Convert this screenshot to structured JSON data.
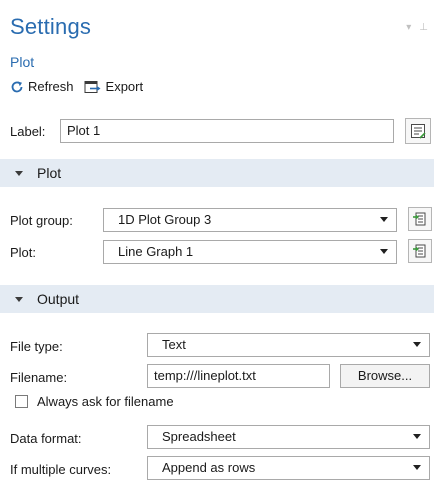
{
  "header": {
    "title": "Settings",
    "subtitle": "Plot",
    "window_controls": [
      "▾",
      "⊥"
    ]
  },
  "toolbar": {
    "refresh_label": "Refresh",
    "export_label": "Export"
  },
  "label_field": {
    "label": "Label:",
    "value": "Plot 1"
  },
  "plot_section": {
    "heading": "Plot",
    "plot_group": {
      "label": "Plot group:",
      "value": "1D Plot Group 3"
    },
    "plot": {
      "label": "Plot:",
      "value": "Line Graph 1"
    }
  },
  "output_section": {
    "heading": "Output",
    "file_type": {
      "label": "File type:",
      "value": "Text"
    },
    "filename": {
      "label": "Filename:",
      "value": "temp:///lineplot.txt",
      "browse_label": "Browse..."
    },
    "always_ask": {
      "label": "Always ask for filename",
      "checked": false
    },
    "data_format": {
      "label": "Data format:",
      "value": "Spreadsheet"
    },
    "multiple_curves": {
      "label": "If multiple curves:",
      "value": "Append as rows"
    }
  },
  "colors": {
    "accent": "#2a6cb0",
    "section_bg": "#e4ebf3"
  }
}
